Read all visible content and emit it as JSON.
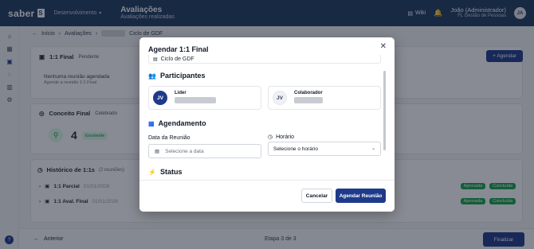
{
  "topbar": {
    "logo": "saber",
    "logo_badge": "S",
    "environment": "Desenvolvimento",
    "title": "Avaliações",
    "subtitle": "Avaliações realizadas",
    "wiki": "Wiki",
    "user_name": "João (Administrador)",
    "user_role": "FL Gestão de Pessoas",
    "user_initials": "JA"
  },
  "breadcrumb": {
    "home": "Início",
    "evaluations": "Avaliações",
    "current": "Ciclo de GDF"
  },
  "background": {
    "section_title": "1:1 Final",
    "section_status": "Pendente",
    "schedule_button": "Agendar",
    "no_meeting_title": "Nenhuma reunião agendada",
    "no_meeting_sub": "Agende a reunião 1:1 Final",
    "concept_title": "Conceito Final",
    "concept_status": "Celebrado",
    "concept_score": "4",
    "concept_label": "Excelente",
    "history_title": "Histórico de 1:1s",
    "history_count": "(2 reuniões)",
    "history": [
      {
        "name": "1:1 Parcial",
        "date": "01/01/2026",
        "badge1": "Aprovada",
        "badge2": "Concluída"
      },
      {
        "name": "1:1 Aval. Final",
        "date": "01/01/2026",
        "badge1": "Aprovada",
        "badge2": "Concluída"
      }
    ],
    "prev_button": "Anterior",
    "page_info": "Etapa 3 de 3",
    "finish_button": "Finalizar"
  },
  "modal": {
    "title": "Agendar 1:1 Final",
    "cycle": "Ciclo de GDF",
    "participants_title": "Participantes",
    "leader_label": "Líder",
    "leader_initials": "JV",
    "collaborator_label": "Colaborador",
    "collaborator_initials": "JV",
    "schedule_title": "Agendamento",
    "date_label": "Data da Reunião",
    "date_placeholder": "Selecione a data",
    "time_label": "Horário",
    "time_placeholder": "Selecione o horário",
    "status_title": "Status",
    "cancel_button": "Cancelar",
    "confirm_button": "Agendar Reunião"
  },
  "icons": {
    "close": "close-icon",
    "participants": "people-icon",
    "schedule": "calendar-icon",
    "time": "clock-icon",
    "status": "lightning-icon"
  }
}
